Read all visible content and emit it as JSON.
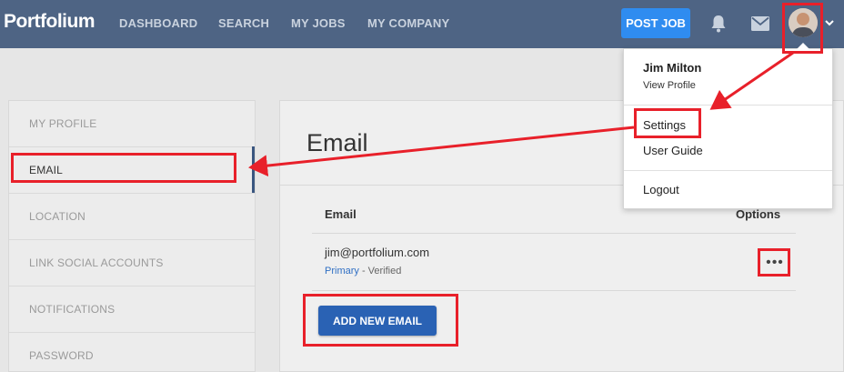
{
  "header": {
    "logo": "Portfolium",
    "nav": [
      "DASHBOARD",
      "SEARCH",
      "MY JOBS",
      "MY COMPANY"
    ],
    "post_job_label": "POST JOB",
    "icons": [
      "bell-icon",
      "mail-icon",
      "avatar",
      "chevron-down-icon"
    ]
  },
  "sidebar": {
    "items": [
      {
        "label": "MY PROFILE"
      },
      {
        "label": "EMAIL"
      },
      {
        "label": "LOCATION"
      },
      {
        "label": "LINK SOCIAL ACCOUNTS"
      },
      {
        "label": "NOTIFICATIONS"
      },
      {
        "label": "PASSWORD"
      }
    ],
    "active": "EMAIL"
  },
  "main": {
    "title": "Email",
    "columns": {
      "email": "Email",
      "options": "Options"
    },
    "rows": [
      {
        "email": "jim@portfolium.com",
        "status_primary": "Primary",
        "status_rest": " - Verified",
        "options_icon": "more-horizontal-icon"
      }
    ],
    "add_button": "ADD NEW EMAIL"
  },
  "dropdown": {
    "user_name": "Jim Milton",
    "view_profile": "View Profile",
    "items": [
      "Settings",
      "User Guide",
      "Logout"
    ]
  },
  "colors": {
    "topbar": "#4e6484",
    "accent_button": "#2f8cf0",
    "primary_button": "#2a62b4",
    "annotation": "#e8202a"
  }
}
